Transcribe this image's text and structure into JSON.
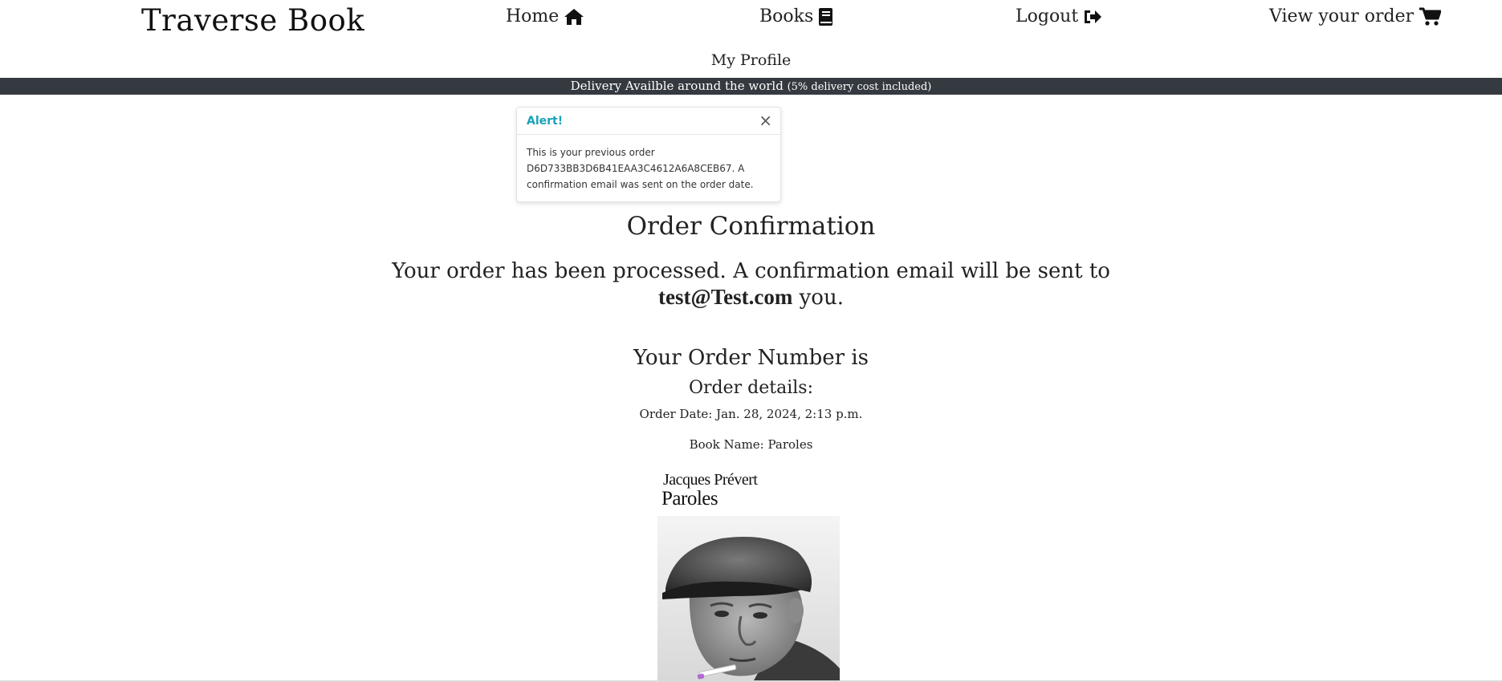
{
  "nav": {
    "brand": "Traverse Book",
    "home": "Home",
    "books": "Books",
    "logout": "Logout",
    "view_order": "View your order",
    "profile": "My Profile"
  },
  "banner": {
    "text": "Delivery Availble around the world",
    "note": "(5% delivery cost included)"
  },
  "toast": {
    "title": "Alert!",
    "close": "×",
    "message": "This is your previous order D6D733BB3D6B41EAA3C4612A6A8CEB67. A confirmation email was sent on the order date."
  },
  "main": {
    "title": "Order Confirmation",
    "processed_text": "Your order has been processed. A confirmation email will be sent to",
    "email": "test@Test.com",
    "processed_suffix": "you.",
    "order_number_label": "Your Order Number is",
    "details_label": "Order details:",
    "order_date": "Order Date: Jan. 28, 2024, 2:13 p.m.",
    "book_name": "Book Name: Paroles"
  },
  "cover": {
    "author": "Jacques Prévert",
    "title": "Paroles"
  },
  "colors": {
    "banner_bg": "#343a40",
    "toast_title": "#17a2b8"
  }
}
